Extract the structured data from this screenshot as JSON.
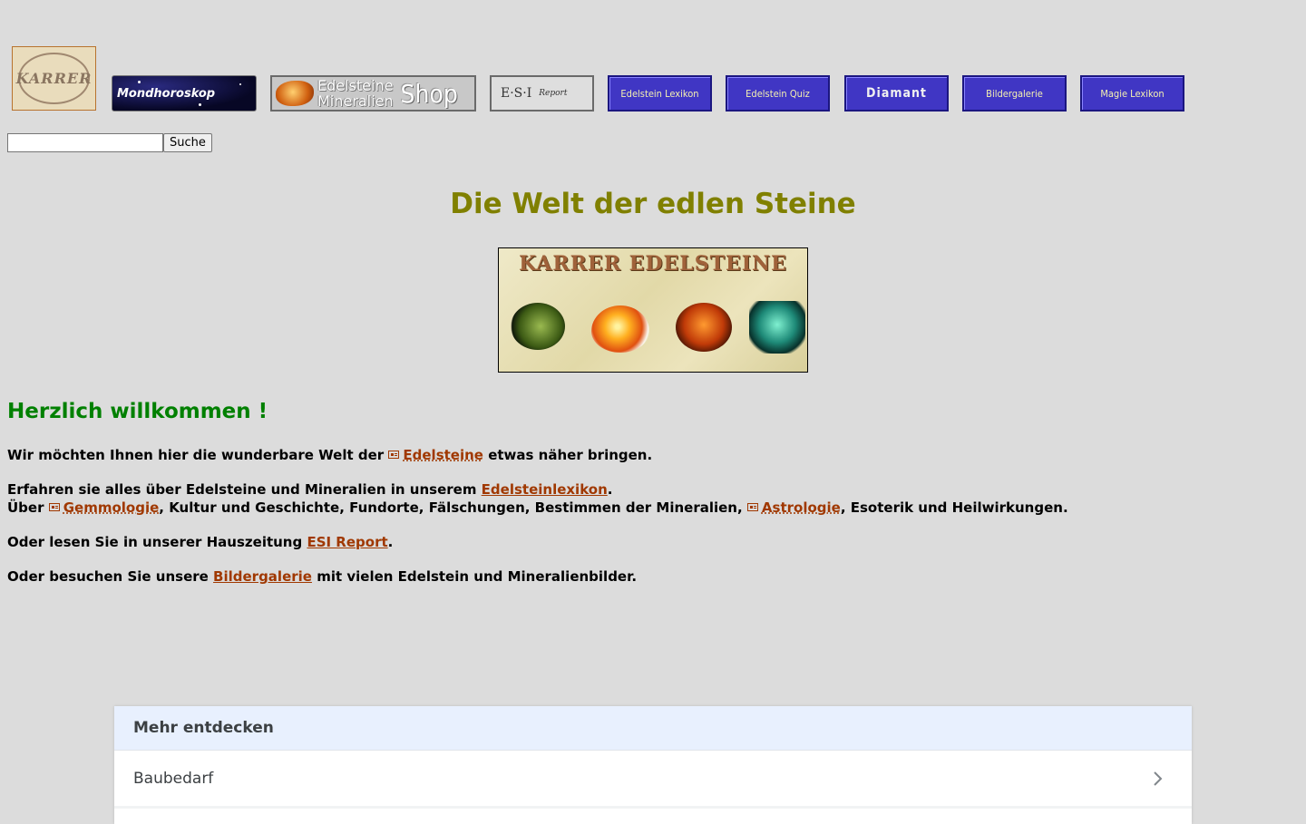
{
  "nav": {
    "logo_text": "KARRER",
    "moon_label": "Mondhoroskop",
    "shop_line1": "Edelsteine",
    "shop_line2": "Mineralien",
    "shop_big": "Shop",
    "esi_label": "E·S·I",
    "esi_small": "Report",
    "lexikon_label": "Edelstein Lexikon",
    "quiz_label": "Edelstein Quiz",
    "diamant_label": "Diamant",
    "galerie_label": "Bildergalerie",
    "magie_label": "Magie Lexikon",
    "colors": {
      "blue_button": "#4036c4",
      "link": "#a03800"
    }
  },
  "search": {
    "value": "",
    "button_label": "Suche"
  },
  "headline": "Die Welt der edlen Steine",
  "banner": {
    "title": "KARRER EDELSTEINE"
  },
  "content": {
    "welcome": "Herzlich willkommen !",
    "p1": {
      "before": "Wir möchten Ihnen hier die wunderbare Welt der ",
      "link": "Edelsteine",
      "after": " etwas näher bringen."
    },
    "p2": {
      "before": "Erfahren sie alles über Edelsteine und Mineralien in unserem ",
      "link": "Edelsteinlexikon",
      "after": "."
    },
    "p2b": {
      "before": "Über ",
      "link1": "Gemmologie",
      "middle": ", Kultur und Geschichte, Fundorte, Fälschungen, Bestimmen der Mineralien, ",
      "link2": "Astrologie",
      "after": ", Esoterik und Heilwirkungen."
    },
    "p3": {
      "before": "Oder lesen Sie in unserer Hauszeitung ",
      "link": "ESI Report",
      "after": "."
    },
    "p4": {
      "before": "Oder besuchen Sie unsere ",
      "link": "Bildergalerie",
      "after": " mit vielen Edelstein und Mineralienbilder."
    }
  },
  "discover": {
    "title": "Mehr entdecken",
    "items": [
      {
        "label": "Baubedarf"
      }
    ]
  }
}
